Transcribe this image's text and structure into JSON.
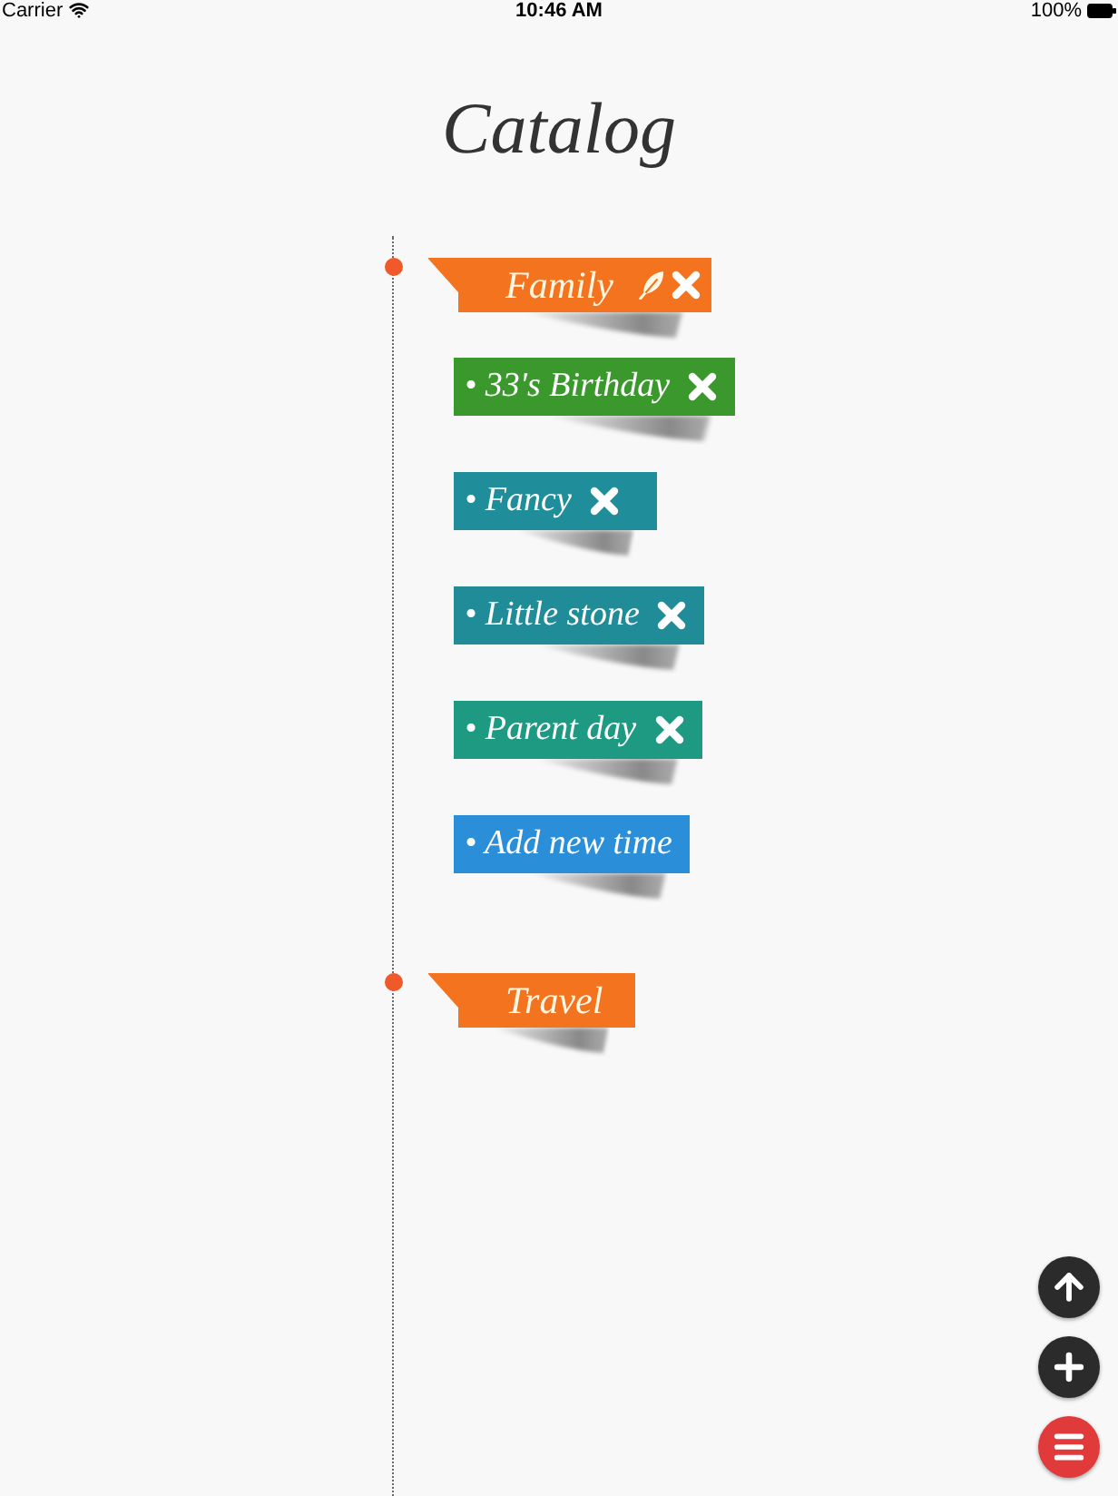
{
  "status_bar": {
    "carrier": "Carrier",
    "time": "10:46 AM",
    "battery": "100%"
  },
  "title": "Catalog",
  "categories": [
    {
      "label": "Family",
      "selected": true,
      "items": [
        {
          "kind": "entry",
          "label": "• 33's Birthday",
          "color": "#3a982c"
        },
        {
          "kind": "entry",
          "label": "• Fancy",
          "color": "#1f8e9a"
        },
        {
          "kind": "entry",
          "label": "• Little stone",
          "color": "#208c98"
        },
        {
          "kind": "entry",
          "label": "• Parent day",
          "color": "#1e9a83"
        },
        {
          "kind": "add",
          "label": "• Add new time",
          "color": "#2a8fd8"
        }
      ]
    },
    {
      "label": "Travel",
      "selected": false
    }
  ]
}
